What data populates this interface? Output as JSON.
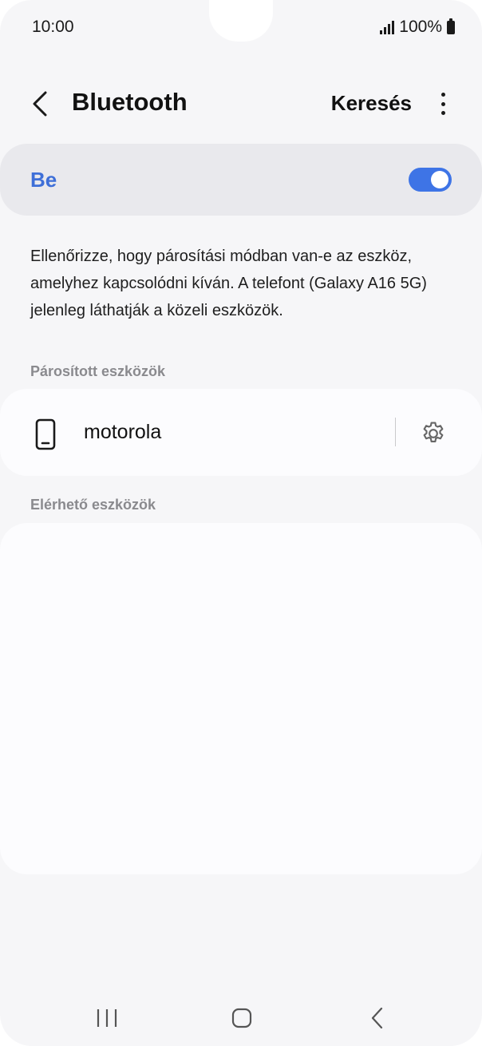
{
  "status_bar": {
    "time": "10:00",
    "battery": "100%",
    "signal_icon": "signal-icon",
    "battery_icon": "battery-icon"
  },
  "header": {
    "title": "Bluetooth",
    "search_label": "Keresés",
    "back_icon": "chevron-left-icon",
    "more_icon": "more-vertical-icon"
  },
  "bluetooth_toggle": {
    "label": "Be",
    "on": true,
    "accent_color": "#3e74e6"
  },
  "description": "Ellenőrizze, hogy párosítási módban van-e az eszköz, amelyhez kapcsolódni kíván. A telefont (Galaxy A16 5G) jelenleg láthatják a közeli eszközök.",
  "paired_section": {
    "label": "Párosított eszközök",
    "devices": [
      {
        "name": "motorola",
        "icon": "smartphone-icon",
        "settings_icon": "gear-icon"
      }
    ]
  },
  "available_section": {
    "label": "Elérhető eszközök",
    "devices": []
  },
  "nav_bar": {
    "recents_icon": "recents-icon",
    "home_icon": "home-icon",
    "back_icon": "back-icon"
  }
}
